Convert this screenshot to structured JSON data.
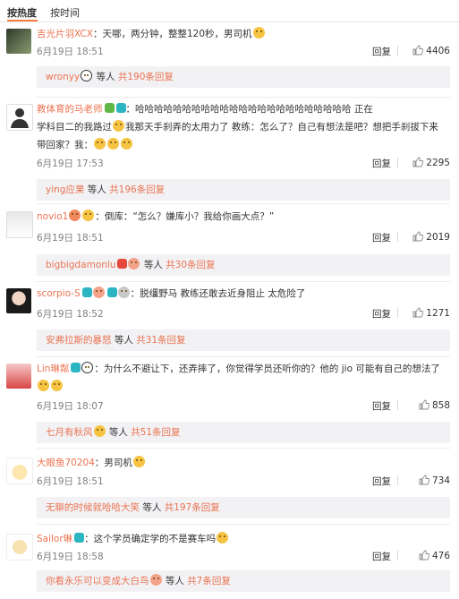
{
  "tabs": [
    {
      "label": "按热度"
    },
    {
      "label": "按时间"
    }
  ],
  "comments": [
    {
      "user": "吉光片羽XCX",
      "text": "：天哪，两分钟，整整120秒，男司机",
      "date": "6月19日 18:51",
      "reply_label": "回复",
      "likes": "4406",
      "reply_user": "wronyy",
      "reply_mid": " 等人 ",
      "reply_count": "共190条回复"
    },
    {
      "user": "教体育的马老师",
      "text_line1": "：哈哈哈哈哈哈哈哈哈哈哈哈哈哈哈哈哈哈哈哈哈哈哈 正在",
      "text_line2": "学科目二的我路过",
      "text_line2b": "我那天手刹弄的太用力了 教练：怎么了？自己有想法是吧？想把手刹拔下来",
      "text_line3": "带回家？我：",
      "date": "6月19日 17:53",
      "reply_label": "回复",
      "likes": "2295",
      "reply_user": "ying应果",
      "reply_mid": " 等人 ",
      "reply_count": "共196条回复"
    },
    {
      "user": "novio1",
      "text": "：倒库：“怎么？嫌库小？我给你画大点？”",
      "date": "6月19日 18:51",
      "reply_label": "回复",
      "likes": "2019",
      "reply_user": "bigbigdamonlu",
      "reply_mid": " 等人 ",
      "reply_count": "共30条回复"
    },
    {
      "user": "scorpio-S",
      "text": "：脱缰野马 教练还敢去近身阻止 太危险了",
      "date": "6月19日 18:52",
      "reply_label": "回复",
      "likes": "1271",
      "reply_user": "安弗拉斯的暴怒",
      "reply_mid": " 等人 ",
      "reply_count": "共31条回复"
    },
    {
      "user": "Lin琳粼",
      "text_line1": "：为什么不避让下，还弄摔了，你觉得学员还听你的？他的 jio 可能有自己的想法了",
      "date": "6月19日 18:07",
      "reply_label": "回复",
      "likes": "858",
      "reply_user": "七月有秋风",
      "reply_mid": " 等人 ",
      "reply_count": "共51条回复"
    },
    {
      "user": "大眼鱼70204",
      "text": "：男司机",
      "date": "6月19日 18:51",
      "reply_label": "回复",
      "likes": "734",
      "reply_user": "无聊的时候就哈哈大笑",
      "reply_mid": " 等人 ",
      "reply_count": "共197条回复"
    },
    {
      "user": "Sailor琳",
      "text": "：这个学员确定学的不是赛车吗",
      "date": "6月19日 18:58",
      "reply_label": "回复",
      "likes": "476",
      "reply_user": "你看永乐可以变成大白鸟",
      "reply_mid": " 等人 ",
      "reply_count": "共7条回复"
    }
  ],
  "icons": {
    "thumb": "thumbs-up-icon",
    "emoji": "emoji-icon",
    "vip": "vip-badge-icon"
  },
  "colors": {
    "username": "#eb7350",
    "reply_bg": "#f2f2f5",
    "tab_accent": "#fa7d3c"
  }
}
